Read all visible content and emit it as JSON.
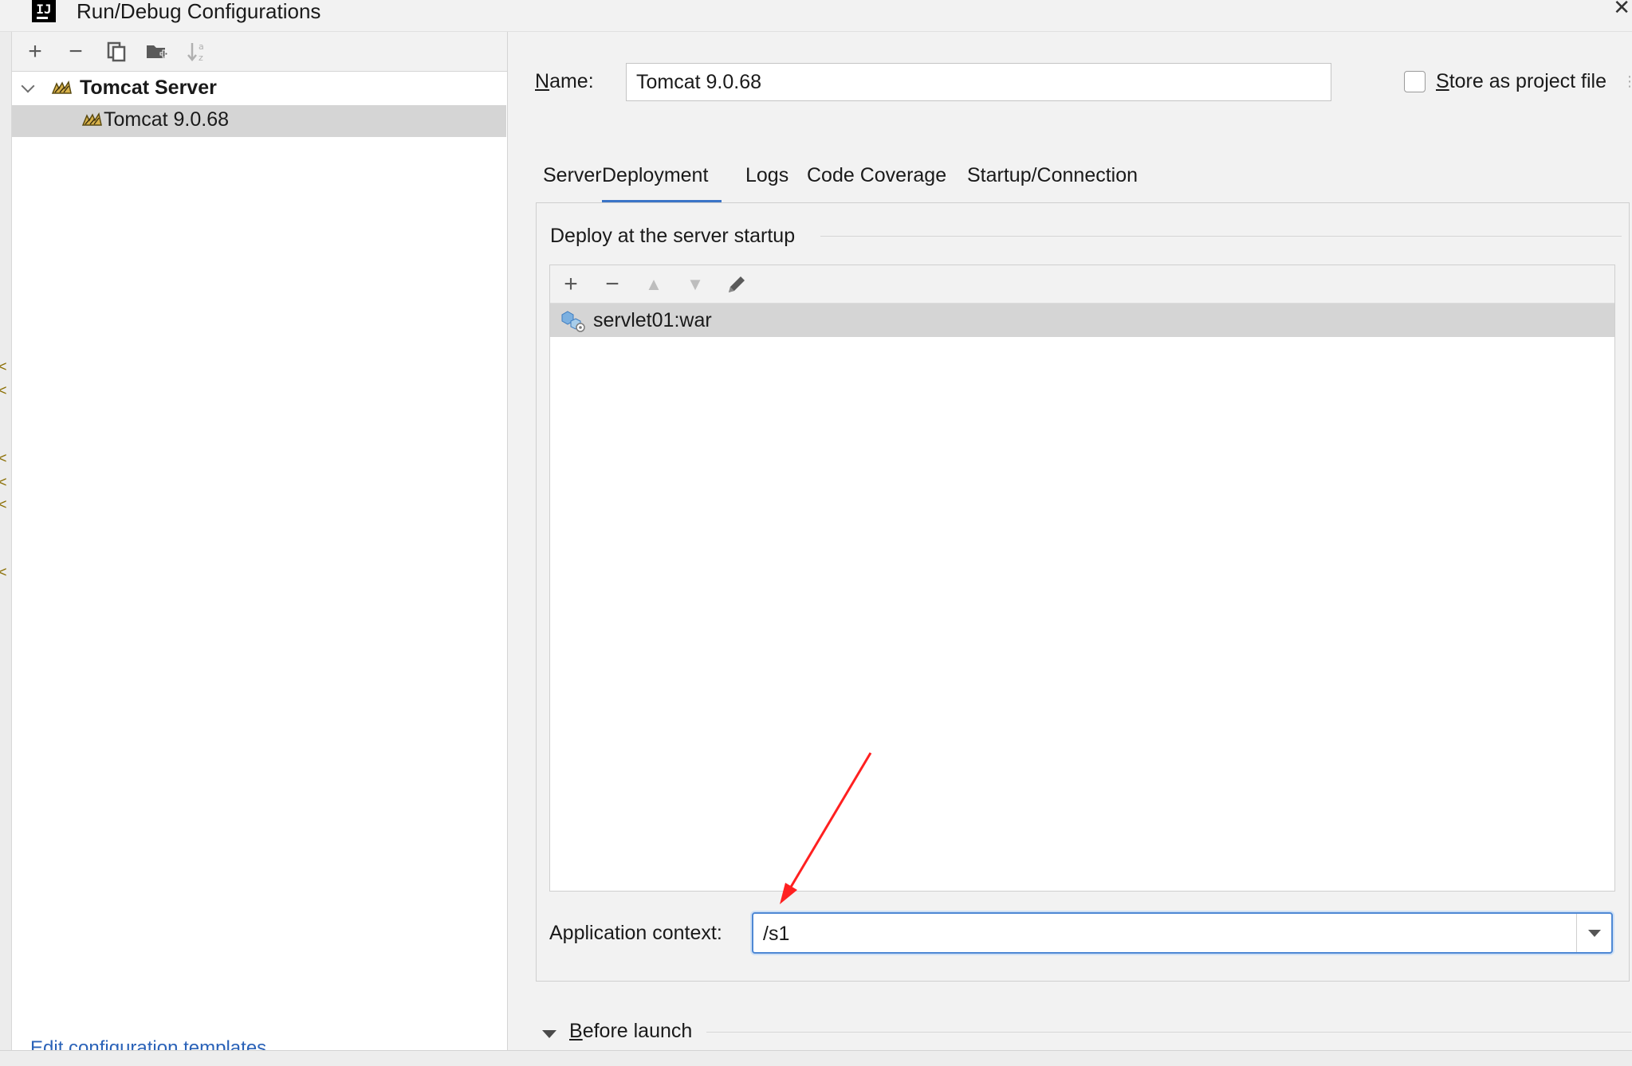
{
  "window": {
    "title": "Run/Debug Configurations",
    "logo_text": "IJ",
    "close_glyph": "✕"
  },
  "left_toolbar": {
    "items": [
      {
        "name": "add-configuration-button",
        "icon": "plus-icon",
        "glyph": "+"
      },
      {
        "name": "remove-configuration-button",
        "icon": "minus-icon",
        "glyph": "−"
      },
      {
        "name": "copy-configuration-button",
        "icon": "copy-icon",
        "glyph": "⧉"
      },
      {
        "name": "move-to-folder-button",
        "icon": "folder-add-icon",
        "glyph": "▙"
      },
      {
        "name": "sort-configurations-button",
        "icon": "sort-alpha-icon",
        "glyph": "⇅"
      }
    ]
  },
  "tree": {
    "group": {
      "label": "Tomcat Server",
      "icon": "tomcat-icon",
      "expanded": true
    },
    "items": [
      {
        "label": "Tomcat 9.0.68",
        "icon": "tomcat-icon",
        "selected": true
      }
    ]
  },
  "edit_templates_link": "Edit configuration templates...",
  "form": {
    "name_label_mnemonic": "N",
    "name_label_rest": "ame:",
    "name_value": "Tomcat 9.0.68",
    "store_checked": false,
    "store_label_mnemonic": "S",
    "store_label_rest": "tore as project file"
  },
  "tabs": [
    {
      "label": "Server",
      "active": false
    },
    {
      "label": "Deployment",
      "active": true
    },
    {
      "label": "Logs",
      "active": false
    },
    {
      "label": "Code Coverage",
      "active": false
    },
    {
      "label": "Startup/Connection",
      "active": false
    }
  ],
  "deployment": {
    "group_title": "Deploy at the server startup",
    "toolbar": [
      {
        "name": "add-artifact-button",
        "icon": "plus-icon",
        "glyph": "+"
      },
      {
        "name": "remove-artifact-button",
        "icon": "minus-icon",
        "glyph": "−"
      },
      {
        "name": "move-up-button",
        "icon": "arrow-up-icon",
        "glyph": "▲"
      },
      {
        "name": "move-down-button",
        "icon": "arrow-down-icon",
        "glyph": "▼"
      },
      {
        "name": "edit-artifact-button",
        "icon": "pencil-icon",
        "glyph": "✎"
      }
    ],
    "artifacts": [
      {
        "label": "servlet01:war",
        "icon": "war-artifact-icon",
        "selected": true
      }
    ],
    "context_label": "Application context:",
    "context_value": "/s1"
  },
  "before_launch": {
    "label_mnemonic": "B",
    "label_rest": "efore launch",
    "expanded": true
  },
  "colors": {
    "accent": "#3b74c7",
    "link": "#2a62b8",
    "selection": "#d5d5d5",
    "annotation": "#ff2020"
  }
}
